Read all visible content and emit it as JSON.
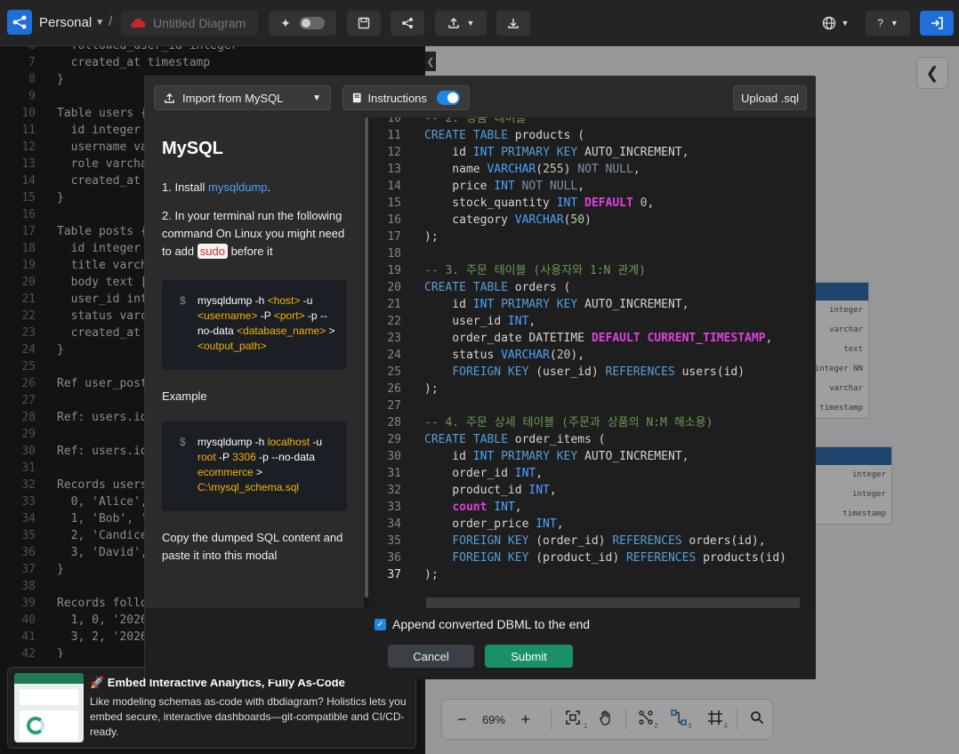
{
  "topbar": {
    "workspace": "Personal",
    "diagram_title_placeholder": "Untitled Diagram",
    "help_label": "?"
  },
  "editor": {
    "lines": [
      {
        "n": "6",
        "t": "  followed_user_id integer"
      },
      {
        "n": "7",
        "t": "  created_at timestamp"
      },
      {
        "n": "8",
        "t": "}"
      },
      {
        "n": "9",
        "t": ""
      },
      {
        "n": "10",
        "t": "Table users {"
      },
      {
        "n": "11",
        "t": "  id integer"
      },
      {
        "n": "12",
        "t": "  username va"
      },
      {
        "n": "13",
        "t": "  role varcha"
      },
      {
        "n": "14",
        "t": "  created_at"
      },
      {
        "n": "15",
        "t": "}"
      },
      {
        "n": "16",
        "t": ""
      },
      {
        "n": "17",
        "t": "Table posts {"
      },
      {
        "n": "18",
        "t": "  id integer"
      },
      {
        "n": "19",
        "t": "  title varch"
      },
      {
        "n": "20",
        "t": "  body text ["
      },
      {
        "n": "21",
        "t": "  user_id int"
      },
      {
        "n": "22",
        "t": "  status varc"
      },
      {
        "n": "23",
        "t": "  created_at"
      },
      {
        "n": "24",
        "t": "}"
      },
      {
        "n": "25",
        "t": ""
      },
      {
        "n": "26",
        "t": "Ref user_post"
      },
      {
        "n": "27",
        "t": ""
      },
      {
        "n": "28",
        "t": "Ref: users.id"
      },
      {
        "n": "29",
        "t": ""
      },
      {
        "n": "30",
        "t": "Ref: users.id"
      },
      {
        "n": "31",
        "t": ""
      },
      {
        "n": "32",
        "t": "Records users"
      },
      {
        "n": "33",
        "t": "  0, 'Alice',"
      },
      {
        "n": "34",
        "t": "  1, 'Bob', '"
      },
      {
        "n": "35",
        "t": "  2, 'Candice"
      },
      {
        "n": "36",
        "t": "  3, 'David',"
      },
      {
        "n": "37",
        "t": "}"
      },
      {
        "n": "38",
        "t": ""
      },
      {
        "n": "39",
        "t": "Records follo"
      },
      {
        "n": "40",
        "t": "  1, 0, '2026"
      },
      {
        "n": "41",
        "t": "  3, 2, '2026"
      },
      {
        "n": "42",
        "t": "}"
      }
    ]
  },
  "canvas_tables": [
    {
      "rows": [
        "integer",
        "varchar",
        "text",
        "integer NN",
        "varchar",
        "timestamp"
      ]
    },
    {
      "rows": [
        "integer",
        "integer",
        "timestamp"
      ]
    }
  ],
  "zoom": {
    "level": "69%",
    "sub1": "1",
    "sub2": "2",
    "sub3": "3",
    "sub4": "4"
  },
  "modal": {
    "source_select": "Import from MySQL",
    "instructions_label": "Instructions",
    "instructions_on": true,
    "upload_label": "Upload .sql",
    "panel": {
      "heading": "MySQL",
      "step1_prefix": "1. Install ",
      "step1_link": "mysqldump",
      "step1_suffix": ".",
      "step2_prefix": "2. In your terminal run the following command On Linux you might need to add ",
      "step2_code": "sudo",
      "step2_suffix": " before it",
      "cmd1": {
        "dollar": "$",
        "a": "mysqldump -h ",
        "host": "<host>",
        "b": " -u ",
        "user": "<username>",
        "c": " -P ",
        "port": "<port>",
        "d": " -p --no-data ",
        "db": "<database_name>",
        "e": " > ",
        "out": "<output_path>"
      },
      "example_label": "Example",
      "cmd2": {
        "dollar": "$",
        "a": "mysqldump -h ",
        "host": "localhost",
        "b": " -u ",
        "user": "root",
        "c": " -P ",
        "port": "3306",
        "d": " -p --no-data ",
        "db": "ecommerce",
        "e": " > ",
        "out": "C:\\mysql_schema.sql"
      },
      "copy_note": "Copy the dumped SQL content and paste it into this modal"
    },
    "code_lines": [
      {
        "n": "10",
        "p": [
          [
            "cm",
            "-- 2. 상품 테이블"
          ]
        ]
      },
      {
        "n": "11",
        "p": [
          [
            "kw",
            "CREATE TABLE"
          ],
          [
            "",
            " products ("
          ]
        ]
      },
      {
        "n": "12",
        "p": [
          [
            "",
            "    id "
          ],
          [
            "ty",
            "INT"
          ],
          [
            "",
            " "
          ],
          [
            "kw",
            "PRIMARY KEY"
          ],
          [
            "",
            " AUTO_INCREMENT,"
          ]
        ]
      },
      {
        "n": "13",
        "p": [
          [
            "",
            "    name "
          ],
          [
            "ty",
            "VARCHAR"
          ],
          [
            "",
            "("
          ],
          [
            "num",
            "255"
          ],
          [
            "",
            ") "
          ],
          [
            "mut",
            "NOT NULL"
          ],
          [
            "",
            ","
          ]
        ]
      },
      {
        "n": "14",
        "p": [
          [
            "",
            "    price "
          ],
          [
            "ty",
            "INT"
          ],
          [
            "",
            " "
          ],
          [
            "mut",
            "NOT NULL"
          ],
          [
            "",
            ","
          ]
        ]
      },
      {
        "n": "15",
        "p": [
          [
            "",
            "    stock_quantity "
          ],
          [
            "ty",
            "INT"
          ],
          [
            "",
            " "
          ],
          [
            "pk",
            "DEFAULT"
          ],
          [
            "",
            " "
          ],
          [
            "num",
            "0"
          ],
          [
            "",
            ","
          ]
        ]
      },
      {
        "n": "16",
        "p": [
          [
            "",
            "    category "
          ],
          [
            "ty",
            "VARCHAR"
          ],
          [
            "",
            "("
          ],
          [
            "num",
            "50"
          ],
          [
            "",
            ")"
          ]
        ]
      },
      {
        "n": "17",
        "p": [
          [
            "",
            ");"
          ]
        ]
      },
      {
        "n": "18",
        "p": [
          [
            "",
            ""
          ]
        ]
      },
      {
        "n": "19",
        "p": [
          [
            "cm",
            "-- 3. 주문 테이블 (사용자와 1:N 관계)"
          ]
        ]
      },
      {
        "n": "20",
        "p": [
          [
            "kw",
            "CREATE TABLE"
          ],
          [
            "",
            " orders ("
          ]
        ]
      },
      {
        "n": "21",
        "p": [
          [
            "",
            "    id "
          ],
          [
            "ty",
            "INT"
          ],
          [
            "",
            " "
          ],
          [
            "kw",
            "PRIMARY KEY"
          ],
          [
            "",
            " AUTO_INCREMENT,"
          ]
        ]
      },
      {
        "n": "22",
        "p": [
          [
            "",
            "    user_id "
          ],
          [
            "ty",
            "INT"
          ],
          [
            "",
            ","
          ]
        ]
      },
      {
        "n": "23",
        "p": [
          [
            "",
            "    order_date DATETIME "
          ],
          [
            "pk",
            "DEFAULT CURRENT_TIMESTAMP"
          ],
          [
            "",
            ","
          ]
        ]
      },
      {
        "n": "24",
        "p": [
          [
            "",
            "    status "
          ],
          [
            "ty",
            "VARCHAR"
          ],
          [
            "",
            "("
          ],
          [
            "num",
            "20"
          ],
          [
            "",
            "),"
          ]
        ]
      },
      {
        "n": "25",
        "p": [
          [
            "",
            "    "
          ],
          [
            "kw",
            "FOREIGN KEY"
          ],
          [
            "",
            " (user_id) "
          ],
          [
            "kw",
            "REFERENCES"
          ],
          [
            "",
            " users(id)"
          ]
        ]
      },
      {
        "n": "26",
        "p": [
          [
            "",
            ");"
          ]
        ]
      },
      {
        "n": "27",
        "p": [
          [
            "",
            ""
          ]
        ]
      },
      {
        "n": "28",
        "p": [
          [
            "cm",
            "-- 4. 주문 상세 테이블 (주문과 상품의 N:M 해소용)"
          ]
        ]
      },
      {
        "n": "29",
        "p": [
          [
            "kw",
            "CREATE TABLE"
          ],
          [
            "",
            " order_items ("
          ]
        ]
      },
      {
        "n": "30",
        "p": [
          [
            "",
            "    id "
          ],
          [
            "ty",
            "INT"
          ],
          [
            "",
            " "
          ],
          [
            "kw",
            "PRIMARY KEY"
          ],
          [
            "",
            " AUTO_INCREMENT,"
          ]
        ]
      },
      {
        "n": "31",
        "p": [
          [
            "",
            "    order_id "
          ],
          [
            "ty",
            "INT"
          ],
          [
            "",
            ","
          ]
        ]
      },
      {
        "n": "32",
        "p": [
          [
            "",
            "    product_id "
          ],
          [
            "ty",
            "INT"
          ],
          [
            "",
            ","
          ]
        ]
      },
      {
        "n": "33",
        "p": [
          [
            "",
            "    "
          ],
          [
            "pk",
            "count"
          ],
          [
            "",
            " "
          ],
          [
            "ty",
            "INT"
          ],
          [
            "",
            ","
          ]
        ]
      },
      {
        "n": "34",
        "p": [
          [
            "",
            "    order_price "
          ],
          [
            "ty",
            "INT"
          ],
          [
            "",
            ","
          ]
        ]
      },
      {
        "n": "35",
        "p": [
          [
            "",
            "    "
          ],
          [
            "kw",
            "FOREIGN KEY"
          ],
          [
            "",
            " (order_id) "
          ],
          [
            "kw",
            "REFERENCES"
          ],
          [
            "",
            " orders(id),"
          ]
        ]
      },
      {
        "n": "36",
        "p": [
          [
            "",
            "    "
          ],
          [
            "kw",
            "FOREIGN KEY"
          ],
          [
            "",
            " (product_id) "
          ],
          [
            "kw",
            "REFERENCES"
          ],
          [
            "",
            " products(id)"
          ]
        ]
      },
      {
        "n": "37",
        "p": [
          [
            "",
            ");"
          ]
        ]
      }
    ],
    "append_label": "Append converted DBML to the end",
    "append_checked": true,
    "cancel_label": "Cancel",
    "submit_label": "Submit"
  },
  "promo": {
    "title": "🚀 Embed Interactive Analytics, Fully As-Code",
    "desc": "Like modeling schemas as-code with dbdiagram? Holistics lets you embed secure, interactive dashboards—git-compatible and CI/CD-ready."
  },
  "colors": {
    "accent": "#1e88e5",
    "submit": "#19906a",
    "keyword": "#569cd6",
    "comment": "#6a9955",
    "default_kw": "#e040e0",
    "arg": "#f5b400"
  }
}
